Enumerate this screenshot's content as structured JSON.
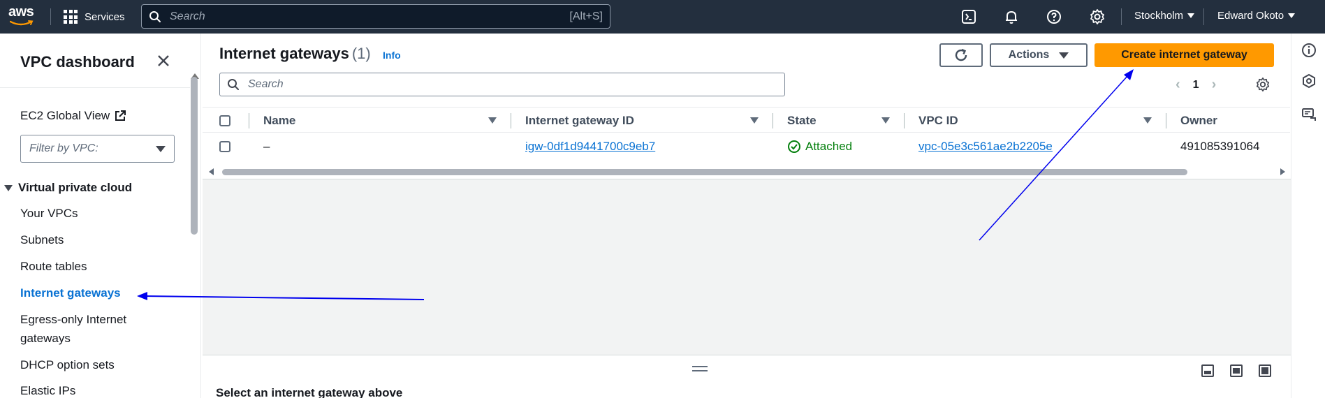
{
  "topnav": {
    "logo_text": "aws",
    "services_label": "Services",
    "search_placeholder": "Search",
    "search_shortcut": "[Alt+S]",
    "region": "Stockholm",
    "user": "Edward Okoto"
  },
  "sidebar": {
    "title": "VPC dashboard",
    "ec2_global_view": "EC2 Global View",
    "filter_placeholder": "Filter by VPC:",
    "section": "Virtual private cloud",
    "items": [
      {
        "label": "Your VPCs"
      },
      {
        "label": "Subnets"
      },
      {
        "label": "Route tables"
      },
      {
        "label": "Internet gateways",
        "active": true
      },
      {
        "label": "Egress-only Internet"
      },
      {
        "label": "gateways"
      },
      {
        "label": "DHCP option sets"
      },
      {
        "label": "Elastic IPs"
      }
    ]
  },
  "main": {
    "title": "Internet gateways",
    "count": "(1)",
    "info": "Info",
    "actions_label": "Actions",
    "create_label": "Create internet gateway",
    "search_placeholder": "Search",
    "page_number": "1",
    "columns": [
      "Name",
      "Internet gateway ID",
      "State",
      "VPC ID",
      "Owner"
    ],
    "rows": [
      {
        "name": "–",
        "igw_id": "igw-0df1d9441700c9eb7",
        "state": "Attached",
        "vpc_id": "vpc-05e3c561ae2b2205e",
        "owner": "491085391064"
      }
    ],
    "split_panel_title": "Select an internet gateway above"
  },
  "colors": {
    "nav_bg": "#232f3e",
    "primary": "#ff9900",
    "link": "#0972d3",
    "success": "#037f0c",
    "annotation_arrow": "#0000ee"
  }
}
